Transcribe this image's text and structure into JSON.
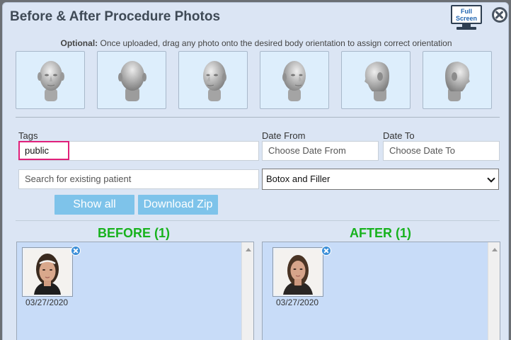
{
  "dialog": {
    "title": "Before & After Procedure Photos",
    "fullscreen_label": "Full Screen"
  },
  "hint": {
    "bold": "Optional:",
    "text": " Once uploaded, drag any photo onto the desired body orientation to assign correct orientation"
  },
  "orientations": [
    {
      "name": "front",
      "icon": "head-front-icon"
    },
    {
      "name": "back",
      "icon": "head-back-icon"
    },
    {
      "name": "front-left",
      "icon": "head-three-quarter-left-icon"
    },
    {
      "name": "front-right",
      "icon": "head-three-quarter-right-icon"
    },
    {
      "name": "left-profile",
      "icon": "head-left-profile-icon"
    },
    {
      "name": "right-profile",
      "icon": "head-right-profile-icon"
    }
  ],
  "filters": {
    "tags_label": "Tags",
    "tags_value": "public",
    "date_from_label": "Date From",
    "date_from_placeholder": "Choose Date From",
    "date_to_label": "Date To",
    "date_to_placeholder": "Choose Date To",
    "patient_placeholder": "Search for existing patient",
    "procedure_selected": "Botox and Filler"
  },
  "buttons": {
    "show_all": "Show all",
    "download_zip": "Download Zip"
  },
  "before": {
    "title": "BEFORE (1)",
    "photos": [
      {
        "date": "03/27/2020"
      }
    ]
  },
  "after": {
    "title": "AFTER (1)",
    "photos": [
      {
        "date": "03/27/2020"
      }
    ]
  },
  "colors": {
    "accent_green": "#17b21d",
    "button_blue": "#7ec3ea",
    "highlight_pink": "#e0207a",
    "panel_blue": "#c8dcf8"
  }
}
